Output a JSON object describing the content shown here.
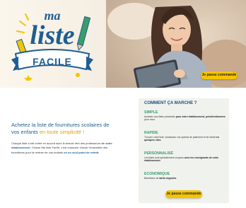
{
  "hero": {
    "logo_line1": "ma",
    "logo_line2": "liste",
    "logo_ribbon": "FACILE",
    "cta_label": "Je passe commande",
    "colors": {
      "logo_blue": "#1e5e92",
      "ribbon": "#3a9d6a",
      "cta": "#f5c400"
    }
  },
  "intro": {
    "title_part1": "Achetez la liste de fournitures scolaires de vos enfants ",
    "title_highlight": "en toute simplicité !",
    "body_part1": "Chaque liste a été créée en accord avec le besoin réel des professeurs ",
    "body_bold1": "de votre établissement",
    "body_part2": ". Choisir ",
    "body_italic": "Ma liste Facile",
    "body_part3": ", c'est s'assurer d'avoir l'ensemble des fournitures pour la rentrée de vos enfants ",
    "body_bold2": "en un seul point de retrait",
    "body_end": "."
  },
  "card": {
    "title": "COMMENT ÇA MARCHE ?",
    "features": [
      {
        "name": "SIMPLE",
        "desc_plain": "Accédez aux listes présentes ",
        "desc_bold": "pour votre établissement, présélectionnées",
        "desc_end": " pour vous."
      },
      {
        "name": "RAPIDE",
        "desc_plain": "Trouvez votre liste, choisissez vos options de paiement et de retrait ",
        "desc_bold": "en quelques clics",
        "desc_end": "."
      },
      {
        "name": "PERSONNALISÉ",
        "desc_plain": "Les listes sont spécialement conçues ",
        "desc_bold": "avec les enseignants de votre établissement",
        "desc_end": "."
      },
      {
        "name": "ECONOMIQUE",
        "desc_plain": "Bénéficiez de ",
        "desc_bold": "tarifs négociés",
        "desc_end": "."
      }
    ],
    "cta_label": "Je passe commande"
  }
}
